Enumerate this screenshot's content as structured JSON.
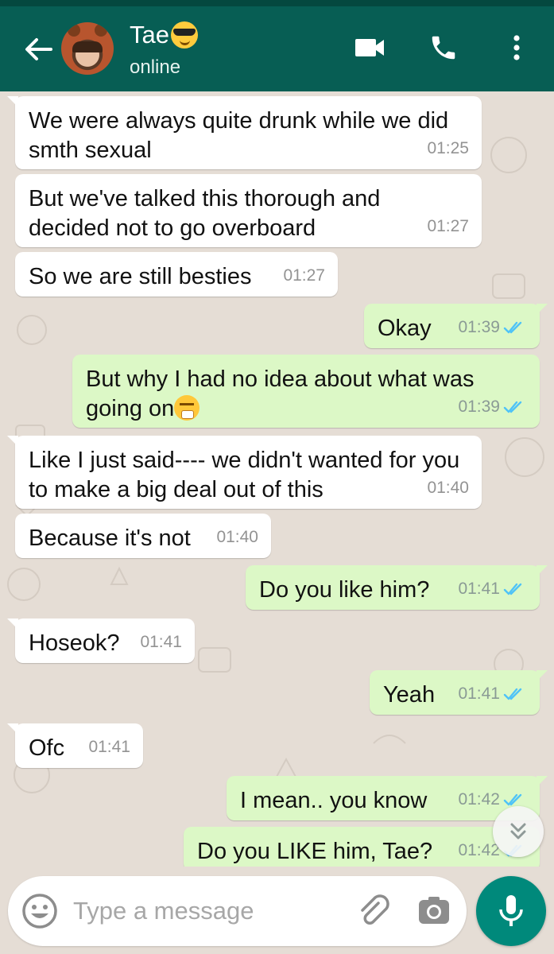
{
  "header": {
    "contact_name": "Tae",
    "status": "online"
  },
  "colors": {
    "header": "#075e54",
    "incoming_bubble": "#ffffff",
    "outgoing_bubble": "#dcf8c6",
    "read_tick": "#4fc3f7",
    "mic_button": "#00897b"
  },
  "icons": {
    "back": "arrow-left-icon",
    "video": "video-camera-icon",
    "call": "phone-icon",
    "menu": "more-vertical-icon",
    "emoji": "smiley-icon",
    "attach": "paperclip-icon",
    "camera": "camera-icon",
    "mic": "microphone-icon",
    "scroll": "double-chevron-down-icon"
  },
  "messages": [
    {
      "dir": "in",
      "text": "We were always quite drunk while we did smth sexual",
      "time": "01:25"
    },
    {
      "dir": "in",
      "text": "But we've talked this thorough and decided not to go overboard",
      "time": "01:27"
    },
    {
      "dir": "in",
      "text": "So we are still besties",
      "time": "01:27"
    },
    {
      "dir": "out",
      "text": "Okay",
      "time": "01:39",
      "read": true
    },
    {
      "dir": "out",
      "text": "But why I had no idea about what was going on",
      "emoji": "steam-from-nose-face",
      "time": "01:39",
      "read": true
    },
    {
      "dir": "in",
      "text": "Like I just said---- we didn't wanted for you to make a big deal out of this",
      "time": "01:40"
    },
    {
      "dir": "in",
      "text": "Because it's not",
      "time": "01:40"
    },
    {
      "dir": "out",
      "text": "Do you like him?",
      "time": "01:41",
      "read": true
    },
    {
      "dir": "in",
      "text": "Hoseok?",
      "time": "01:41"
    },
    {
      "dir": "out",
      "text": "Yeah",
      "time": "01:41",
      "read": true
    },
    {
      "dir": "in",
      "text": "Ofc",
      "time": "01:41"
    },
    {
      "dir": "out",
      "text": "I mean.. you know",
      "time": "01:42",
      "read": true
    },
    {
      "dir": "out",
      "text": "Do you LIKE him, Tae?",
      "time": "01:42",
      "read": true
    }
  ],
  "composer": {
    "placeholder": "Type a message"
  }
}
